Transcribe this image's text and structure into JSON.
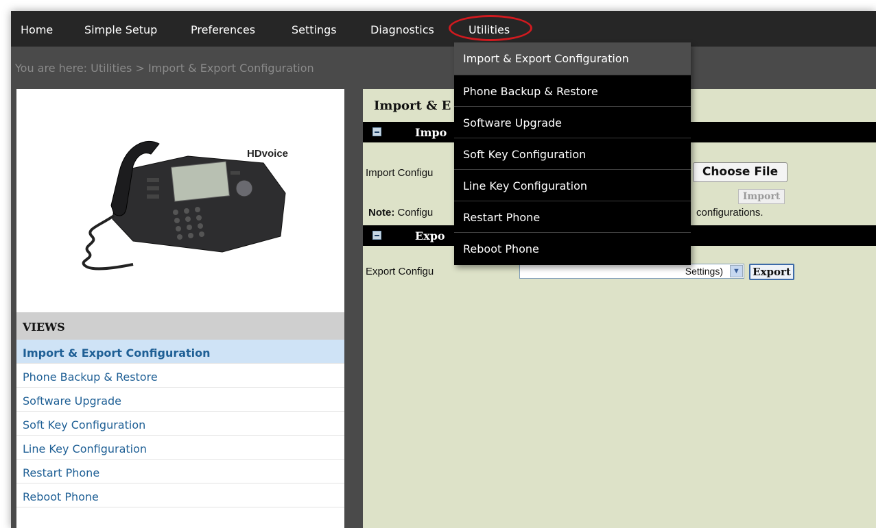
{
  "nav": {
    "items": [
      {
        "label": "Home"
      },
      {
        "label": "Simple Setup"
      },
      {
        "label": "Preferences"
      },
      {
        "label": "Settings"
      },
      {
        "label": "Diagnostics"
      },
      {
        "label": "Utilities"
      }
    ]
  },
  "breadcrumb": "You are here: Utilities > Import & Export Configuration",
  "phone": {
    "brand_logo": "HDvoice"
  },
  "views": {
    "header": "VIEWS",
    "items": [
      {
        "label": "Import & Export Configuration",
        "active": true
      },
      {
        "label": "Phone Backup & Restore"
      },
      {
        "label": "Software Upgrade"
      },
      {
        "label": "Soft Key Configuration"
      },
      {
        "label": "Line Key Configuration"
      },
      {
        "label": "Restart Phone"
      },
      {
        "label": "Reboot Phone"
      }
    ]
  },
  "content": {
    "title": "Import & E",
    "import_section_label": "Impo",
    "import_row_label": "Import Configu",
    "choose_file_label": "Choose File",
    "import_button_label": "Import",
    "note_bold": "Note:",
    "note_left": " Configu",
    "note_right": "configurations.",
    "export_section_label": "Expo",
    "export_row_label": "Export Configu",
    "export_select_value": "Settings)",
    "export_button_label": "Export"
  },
  "dropdown": {
    "items": [
      {
        "label": "Import & Export Configuration",
        "hover": true
      },
      {
        "label": "Phone Backup & Restore"
      },
      {
        "label": "Software Upgrade"
      },
      {
        "label": "Soft Key Configuration"
      },
      {
        "label": "Line Key Configuration"
      },
      {
        "label": "Restart Phone"
      },
      {
        "label": "Reboot Phone"
      }
    ]
  },
  "colors": {
    "highlight_circle": "#d11a1f",
    "content_bg": "#dde2c8",
    "link": "#1e5f95"
  }
}
